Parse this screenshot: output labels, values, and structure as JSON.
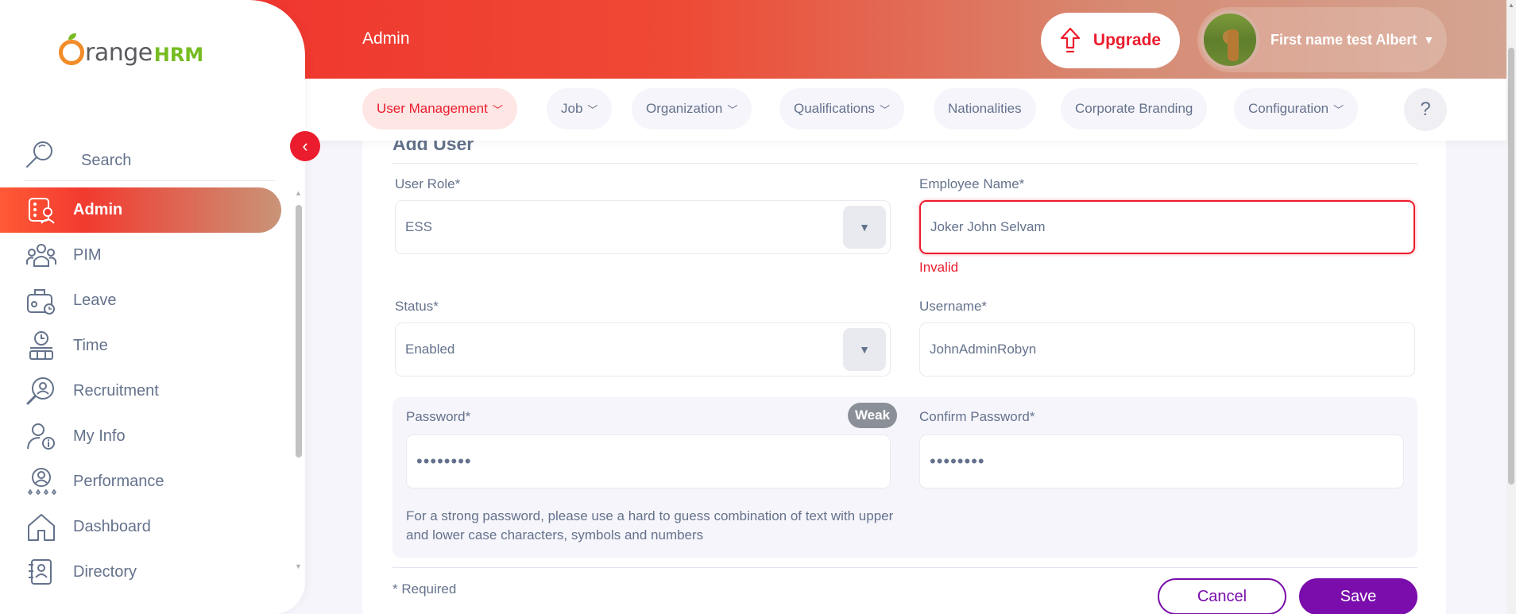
{
  "brand": {
    "word": "range",
    "hrm": "HRM"
  },
  "sidebar": {
    "search_label": "Search",
    "items": [
      {
        "label": "Admin",
        "icon": "admin-icon",
        "active": true
      },
      {
        "label": "PIM",
        "icon": "pim-icon"
      },
      {
        "label": "Leave",
        "icon": "leave-icon"
      },
      {
        "label": "Time",
        "icon": "time-icon"
      },
      {
        "label": "Recruitment",
        "icon": "recruitment-icon"
      },
      {
        "label": "My Info",
        "icon": "my-info-icon"
      },
      {
        "label": "Performance",
        "icon": "performance-icon"
      },
      {
        "label": "Dashboard",
        "icon": "dashboard-icon"
      },
      {
        "label": "Directory",
        "icon": "directory-icon"
      }
    ]
  },
  "header": {
    "title": "Admin",
    "upgrade_label": "Upgrade",
    "user_name": "First name test Albert"
  },
  "subnav": {
    "tabs": [
      {
        "label": "User Management",
        "has_menu": true,
        "active": true
      },
      {
        "label": "Job",
        "has_menu": true
      },
      {
        "label": "Organization",
        "has_menu": true
      },
      {
        "label": "Qualifications",
        "has_menu": true
      },
      {
        "label": "Nationalities",
        "has_menu": false
      },
      {
        "label": "Corporate Branding",
        "has_menu": false
      },
      {
        "label": "Configuration",
        "has_menu": true
      }
    ],
    "help_label": "?"
  },
  "form": {
    "title": "Add User",
    "user_role": {
      "label": "User Role*",
      "value": "ESS"
    },
    "employee_name": {
      "label": "Employee Name*",
      "value": "Joker John Selvam",
      "error": "Invalid"
    },
    "status": {
      "label": "Status*",
      "value": "Enabled"
    },
    "username": {
      "label": "Username*",
      "value": "JohnAdminRobyn"
    },
    "password": {
      "label": "Password*",
      "value": "••••••••",
      "strength": "Weak"
    },
    "confirm_password": {
      "label": "Confirm Password*",
      "value": "••••••••"
    },
    "password_hint": "For a strong password, please use a hard to guess combination of text with upper and lower case characters, symbols and numbers",
    "required_note": "* Required",
    "cancel_label": "Cancel",
    "save_label": "Save"
  },
  "colors": {
    "accent": "#eb1c2d",
    "brand_orange": "#f28c28",
    "brand_green": "#76bc21",
    "primary_button": "#7a0dab",
    "text": "#64728c"
  }
}
